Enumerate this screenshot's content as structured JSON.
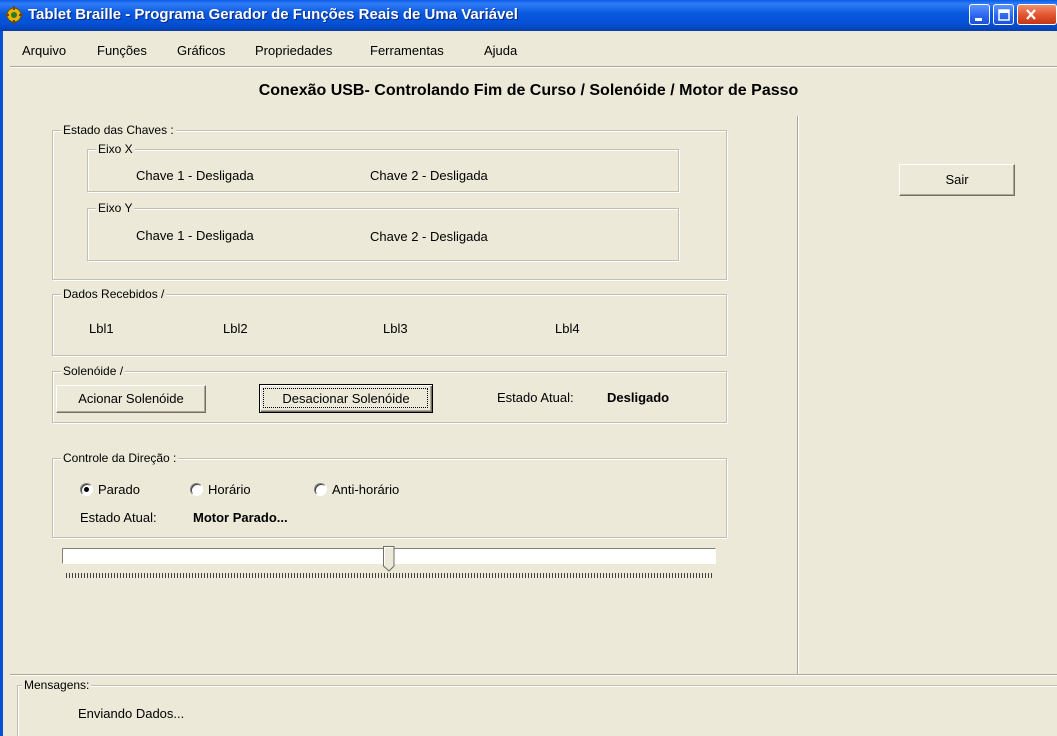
{
  "window": {
    "title": "Tablet Braille - Programa Gerador de Funções Reais de Uma Variável",
    "icon": "app-gear-icon",
    "controls": {
      "minimize": "minimize-icon",
      "maximize": "maximize-icon",
      "close": "close-icon"
    }
  },
  "menu": {
    "items": [
      "Arquivo",
      "Funções",
      "Gráficos",
      "Propriedades",
      "Ferramentas",
      "Ajuda"
    ]
  },
  "heading": "Conexão USB- Controlando Fim de Curso / Solenóide / Motor de Passo",
  "estado_chaves": {
    "label": "Estado das Chaves :",
    "eixo_x": {
      "label": "Eixo X",
      "chave1": "Chave 1 - Desligada",
      "chave2": "Chave 2 - Desligada"
    },
    "eixo_y": {
      "label": "Eixo Y",
      "chave1": "Chave 1 - Desligada",
      "chave2": "Chave 2 - Desligada"
    }
  },
  "dados_recebidos": {
    "label": "Dados Recebidos /",
    "labels": [
      "Lbl1",
      "Lbl2",
      "Lbl3",
      "Lbl4"
    ]
  },
  "solenoide": {
    "label": "Solenóide /",
    "acionar_button": "Acionar Solenóide",
    "desacionar_button": "Desacionar Solenóide",
    "estado_label": "Estado Atual:",
    "estado_value": "Desligado"
  },
  "direcao": {
    "label": "Controle da Direção :",
    "options": [
      "Parado",
      "Horário",
      "Anti-horário"
    ],
    "selected": "Parado",
    "estado_label": "Estado Atual:",
    "estado_value": "Motor Parado..."
  },
  "slider": {
    "value_fraction": 0.5
  },
  "sair_button": "Sair",
  "mensagens": {
    "label": "Mensagens:",
    "text": "Enviando Dados..."
  },
  "colors": {
    "titlebar": "#0550d5",
    "window_bg": "#ece9d8",
    "close_button": "#e2532e"
  }
}
